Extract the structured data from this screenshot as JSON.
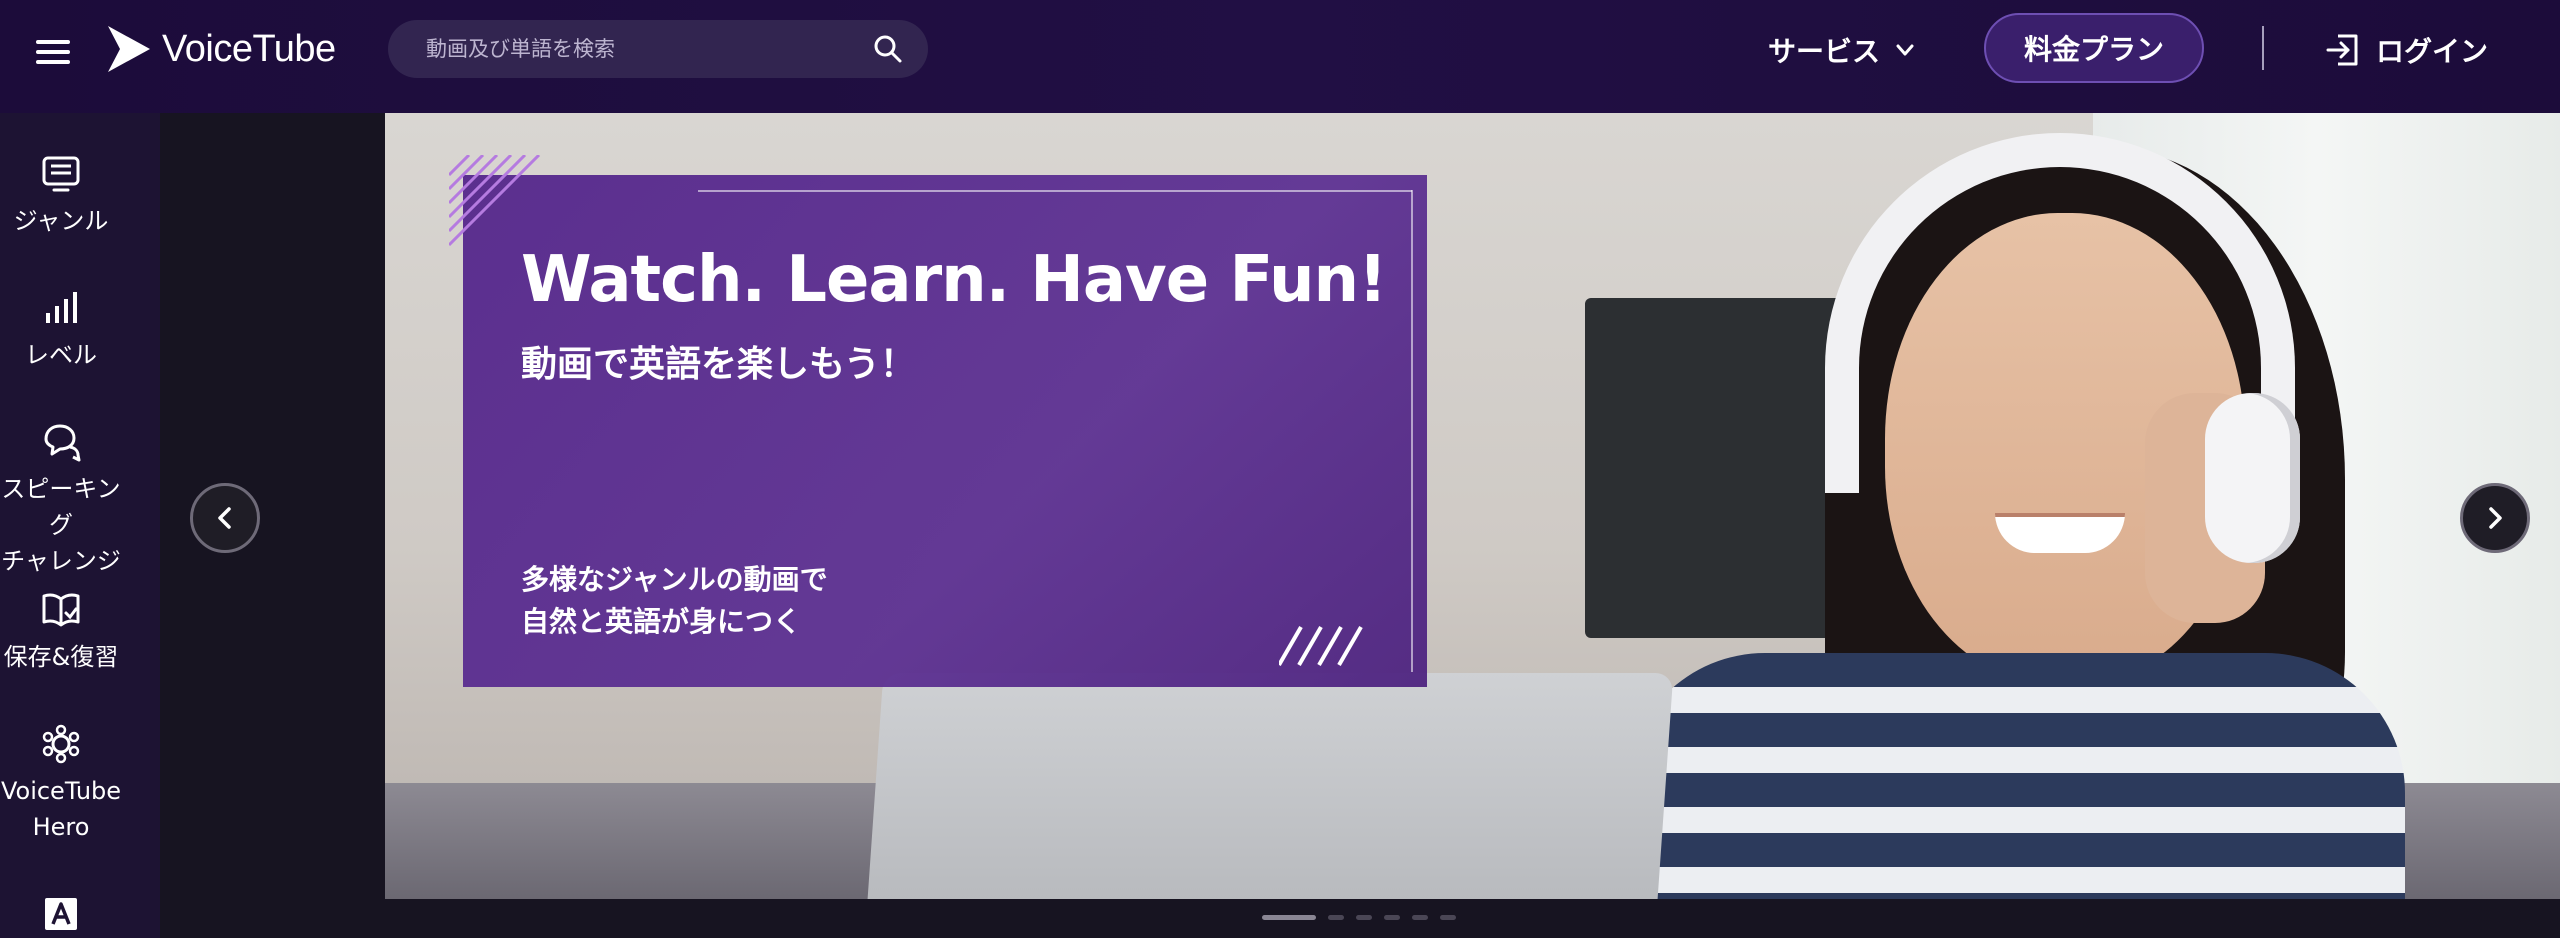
{
  "header": {
    "brand": "VoiceTube",
    "search_placeholder": "動画及び単語を検索",
    "services_label": "サービス",
    "pricing_label": "料金プラン",
    "login_label": "ログイン"
  },
  "sidebar": {
    "items": [
      {
        "label": "ジャンル",
        "icon": "genre-icon"
      },
      {
        "label": "レベル",
        "icon": "level-bars-icon"
      },
      {
        "label": "スピーキング\nチャレンジ",
        "icon": "speech-bubbles-icon"
      },
      {
        "label": "保存&復習",
        "icon": "book-check-icon"
      },
      {
        "label": "VoiceTube\nHero",
        "icon": "hero-icon"
      },
      {
        "label": "",
        "icon": "letter-a-icon"
      }
    ]
  },
  "banner": {
    "title": "Watch. Learn. Have Fun!",
    "subtitle": "動画で英語を楽しもう！",
    "body": "多様なジャンルの動画で\n自然と英語が身につく",
    "slide_count": 6,
    "active_slide": 1
  },
  "colors": {
    "header_bg": "#1c0c3a",
    "promo_purple": "#56288c",
    "pricing_border": "#6e4fb3",
    "page_bg": "#171421"
  }
}
